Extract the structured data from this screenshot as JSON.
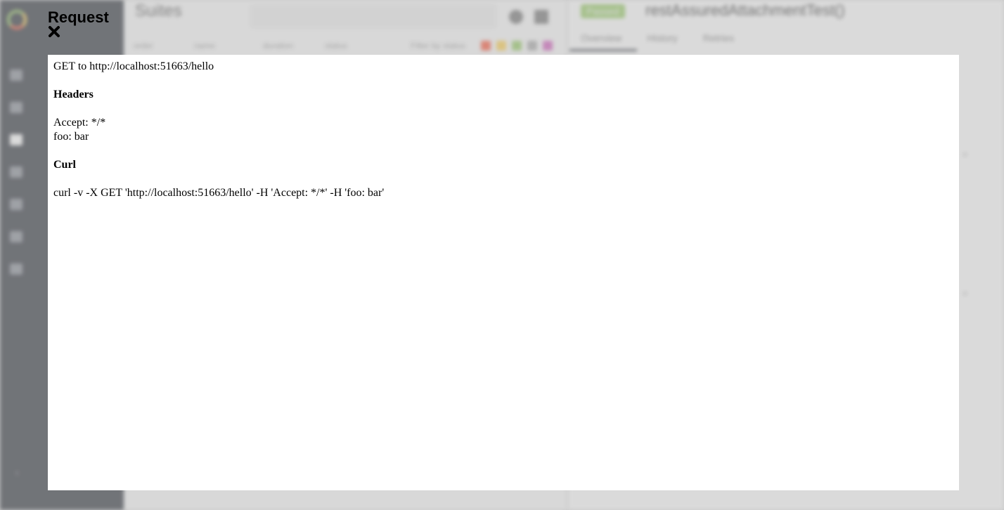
{
  "modal": {
    "title": "Request",
    "close_icon": "close-icon",
    "request_line": "GET to http://localhost:51663/hello",
    "headers_heading": "Headers",
    "headers": [
      "Accept: */*",
      "foo: bar"
    ],
    "curl_heading": "Curl",
    "curl_command": "curl -v -X GET 'http://localhost:51663/hello' -H 'Accept: */*' -H 'foo: bar'"
  },
  "background": {
    "sidebar": {
      "logo_icon": "allure-logo-icon"
    },
    "suites": {
      "title": "Suites",
      "filter_label": "Filter by status",
      "sort_columns": [
        "order",
        "name",
        "duration",
        "status"
      ],
      "status_colors": [
        "#fd5a3e",
        "#ffd050",
        "#97cc64",
        "#aaaaaa",
        "#d35ebe"
      ]
    },
    "test": {
      "status_badge": "Passed",
      "title": "restAssuredAttachmentTest()",
      "tabs": [
        "Overview",
        "History",
        "Retries"
      ]
    },
    "colors": {
      "sidebar_bg": "#2f343d",
      "passed": "#97cc64"
    }
  }
}
